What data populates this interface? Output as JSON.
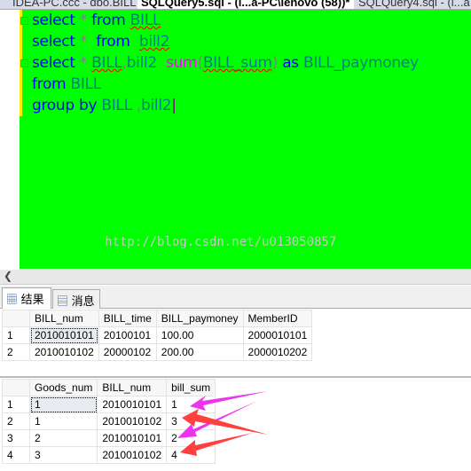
{
  "tabs": [
    "IDEA-PC.ccc - dbo.BILL",
    "SQLQuery5.sql - (l...a-PC\\lenovo (58))*",
    "SQLQuery4.sql - (l...a"
  ],
  "editor": {
    "watermark": "http://blog.csdn.net/u013050857"
  },
  "results": {
    "tab_results": "结果",
    "tab_messages": "消息",
    "grid1": {
      "columns": [
        "",
        "BILL_num",
        "BILL_time",
        "BILL_paymoney",
        "MemberID"
      ],
      "rows": [
        [
          "1",
          "2010010101",
          "20100101",
          "100.00",
          "2000010101"
        ],
        [
          "2",
          "2010010102",
          "20000102",
          "200.00",
          "2000010202"
        ]
      ]
    },
    "grid2": {
      "columns": [
        "",
        "Goods_num",
        "BILL_num",
        "bill_sum"
      ],
      "rows": [
        [
          "1",
          "1",
          "2010010101",
          "1"
        ],
        [
          "2",
          "1",
          "2010010102",
          "3"
        ],
        [
          "3",
          "2",
          "2010010101",
          "2"
        ],
        [
          "4",
          "3",
          "2010010102",
          "4"
        ]
      ]
    }
  },
  "colors": {
    "editor_bg": "#00ff00",
    "keyword": "#0000ff",
    "identifier": "#008080",
    "arrow_magenta": "#ee33ee",
    "arrow_red": "#ff4040"
  }
}
